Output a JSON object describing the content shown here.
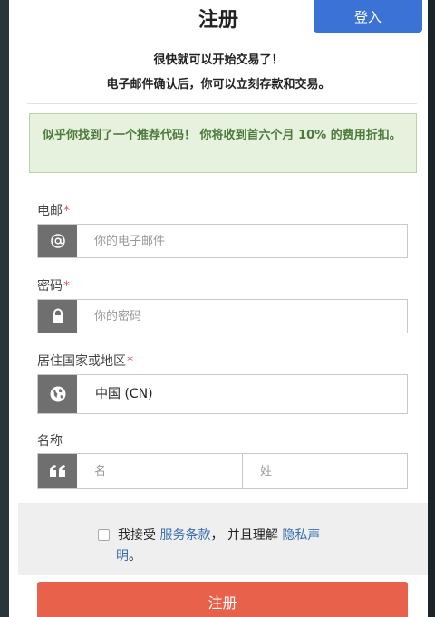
{
  "header": {
    "title": "注册",
    "login_label": "登入"
  },
  "intro": {
    "line1": "很快就可以开始交易了！",
    "line2": "电子邮件确认后，你可以立刻存款和交易。"
  },
  "promo": {
    "text_before": "似乎你找到了一个推荐代码！ 你将收到首六个月 ",
    "discount": "10%",
    "text_after": " 的费用折扣。"
  },
  "form": {
    "email": {
      "label": "电邮",
      "required": "*",
      "placeholder": "你的电子邮件",
      "icon": "at-icon"
    },
    "password": {
      "label": "密码",
      "required": "*",
      "placeholder": "你的密码",
      "icon": "lock-icon"
    },
    "country": {
      "label": "居住国家或地区",
      "required": "*",
      "value": "中国 (CN)",
      "icon": "globe-icon"
    },
    "name": {
      "label": "名称",
      "first_placeholder": "名",
      "last_placeholder": "姓",
      "icon": "quote-icon"
    }
  },
  "agreement": {
    "prefix": "我接受 ",
    "terms_link": "服务条款",
    "middle": "， 并且理解 ",
    "privacy_link_part1": "隐私声",
    "privacy_link_part2": "明",
    "suffix": "。"
  },
  "submit_label": "注册",
  "colors": {
    "login_button": "#3a72d6",
    "submit_button": "#e8614a",
    "promo_bg": "#e6f1de",
    "promo_text": "#4b7a3a",
    "link": "#3a6fb0",
    "required": "#d9534f",
    "addon": "#6f6f6f"
  }
}
